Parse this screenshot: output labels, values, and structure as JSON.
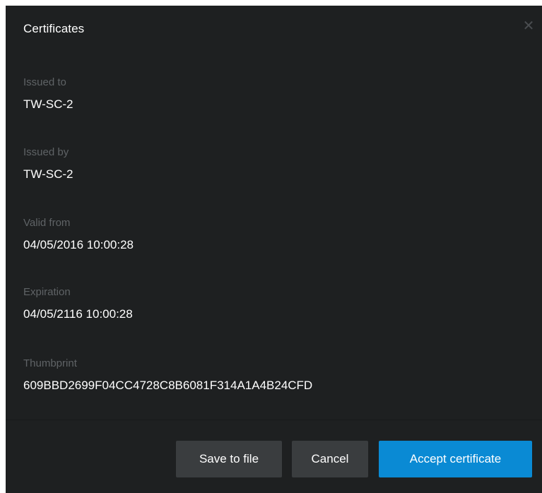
{
  "dialog": {
    "title": "Certificates",
    "close_icon": "close-icon",
    "close_glyph": "✕"
  },
  "fields": [
    {
      "label": "Issued to",
      "value": "TW-SC-2"
    },
    {
      "label": "Issued by",
      "value": "TW-SC-2"
    },
    {
      "label": "Valid from",
      "value": "04/05/2016 10:00:28"
    },
    {
      "label": "Expiration",
      "value": "04/05/2116 10:00:28"
    },
    {
      "label": "Thumbprint",
      "value": "609BBD2699F04CC4728C8B6081F314A1A4B24CFD"
    }
  ],
  "buttons": {
    "save_label": "Save to file",
    "cancel_label": "Cancel",
    "accept_label": "Accept certificate"
  },
  "colors": {
    "background": "#1e2021",
    "label": "#5f6366",
    "value": "#ffffff",
    "secondary_button": "#3a3d3f",
    "primary_button": "#0a8ad4"
  }
}
